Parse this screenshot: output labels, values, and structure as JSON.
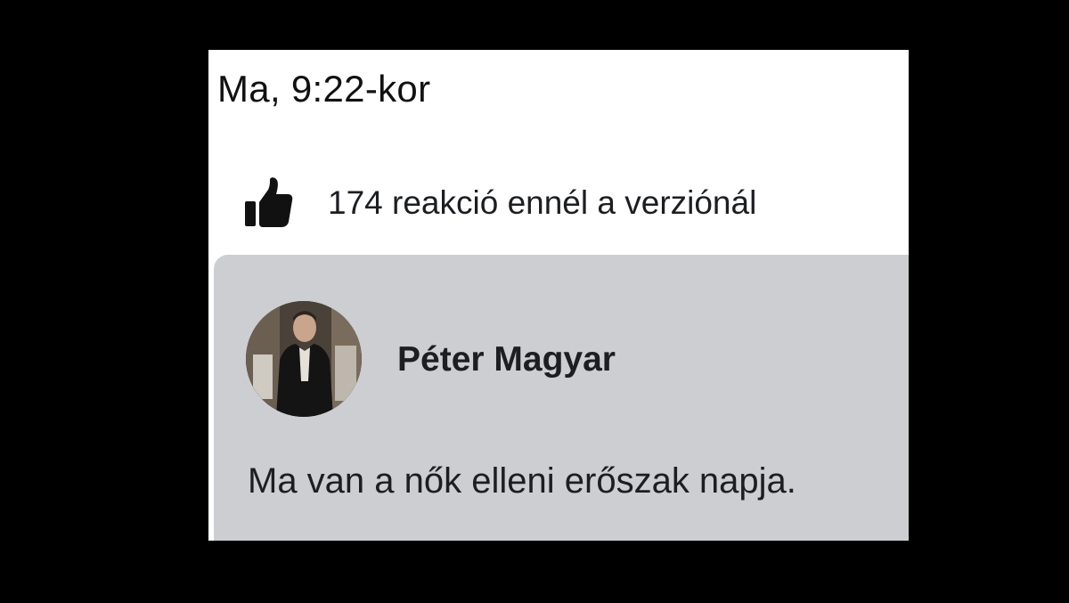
{
  "history_entry": {
    "timestamp": "Ma, 9:22-kor",
    "reactions": {
      "icon": "thumbs-up-icon",
      "text": "174 reakció ennél a verziónál"
    }
  },
  "post": {
    "author": {
      "name": "Péter Magyar",
      "avatar": "profile-photo"
    },
    "text": "Ma van a nők elleni erőszak napja."
  },
  "colors": {
    "background": "#000000",
    "panel": "#ffffff",
    "post_card": "#ccced2",
    "text": "#1c1e21"
  }
}
